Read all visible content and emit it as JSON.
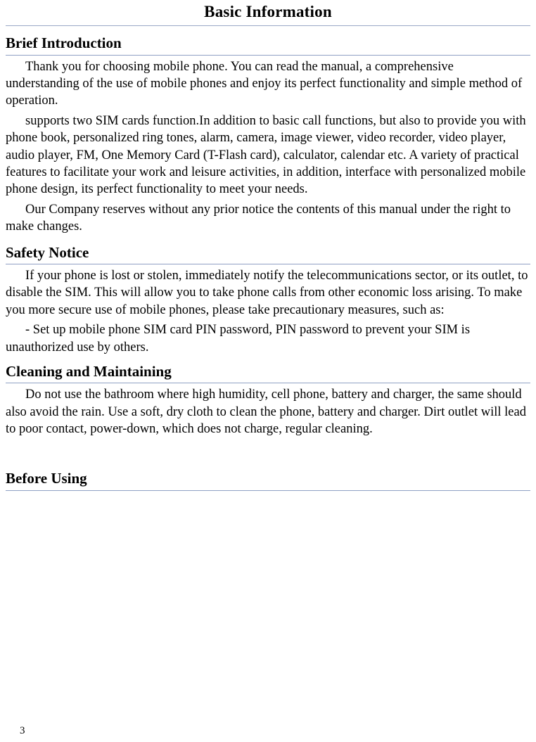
{
  "document": {
    "title": "Basic Information",
    "page_number": "3",
    "sections": [
      {
        "heading": "Brief Introduction",
        "paragraphs": [
          "Thank you for choosing mobile phone. You can read the manual, a comprehensive understanding of the use of mobile phones and enjoy its perfect functionality and simple method of operation.",
          "supports two SIM cards function.In addition to basic call functions, but also to provide you with phone book, personalized ring tones, alarm, camera, image viewer, video recorder, video player, audio player, FM, One Memory Card (T-Flash card), calculator, calendar etc. A variety of practical features to facilitate your work and leisure activities, in addition, interface with personalized mobile phone design, its perfect functionality to meet your needs.",
          "Our Company reserves without any prior notice the contents of this manual under the right to make changes."
        ]
      },
      {
        "heading": "Safety Notice",
        "paragraphs": [
          "If your phone is lost or stolen, immediately notify the telecommunications sector, or its outlet, to disable the SIM. This will allow you to take phone calls from other economic loss arising. To make you more secure use of mobile phones, please take precautionary measures, such as:",
          "- Set up mobile phone SIM card PIN password, PIN password to prevent your SIM is unauthorized use by others."
        ]
      },
      {
        "heading": "Cleaning and Maintaining",
        "paragraphs": [
          "Do not use the bathroom where high humidity, cell phone, battery and charger, the same should also avoid the rain. Use a soft, dry cloth to clean the phone, battery and charger. Dirt outlet will lead to poor contact, power-down, which does not charge, regular cleaning."
        ]
      },
      {
        "heading": "Before Using",
        "paragraphs": []
      }
    ]
  }
}
